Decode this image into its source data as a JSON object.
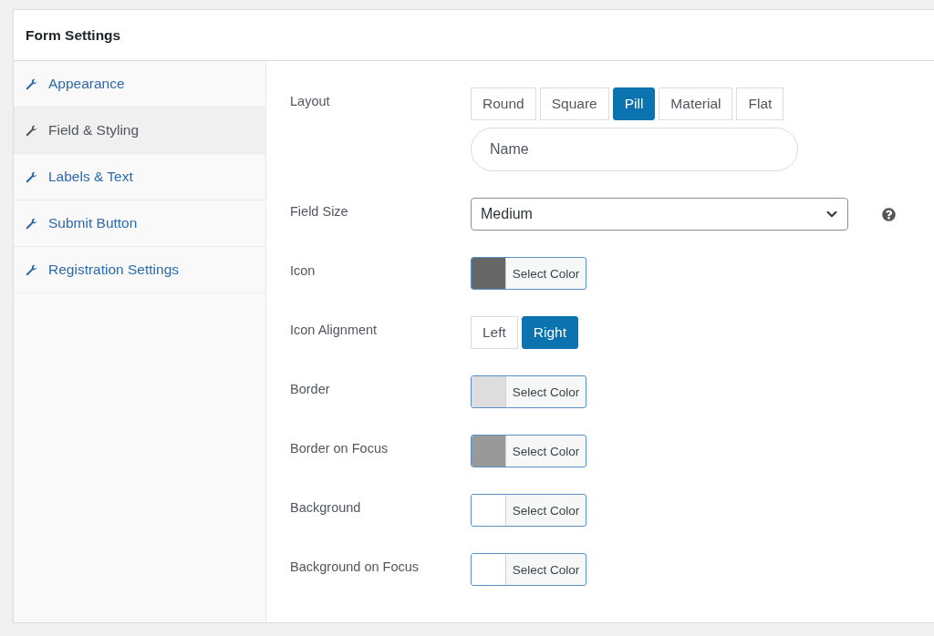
{
  "panel": {
    "title": "Form Settings"
  },
  "sidebar": {
    "items": [
      {
        "label": "Appearance",
        "selected": false
      },
      {
        "label": "Field & Styling",
        "selected": true
      },
      {
        "label": "Labels & Text",
        "selected": false
      },
      {
        "label": "Submit Button",
        "selected": false
      },
      {
        "label": "Registration Settings",
        "selected": false
      }
    ]
  },
  "settings": [
    {
      "kind": "buttons",
      "label": "Layout",
      "options": [
        {
          "label": "Round",
          "selected": false
        },
        {
          "label": "Square",
          "selected": false
        },
        {
          "label": "Pill",
          "selected": true
        },
        {
          "label": "Material",
          "selected": false
        },
        {
          "label": "Flat",
          "selected": false
        }
      ],
      "preview": {
        "placeholder": "Name"
      }
    },
    {
      "kind": "select",
      "label": "Field Size",
      "value": "Medium"
    },
    {
      "kind": "color",
      "label": "Icon",
      "color": "#666666",
      "button": "Select Color"
    },
    {
      "kind": "buttons",
      "label": "Icon Alignment",
      "options": [
        {
          "label": "Left",
          "selected": false
        },
        {
          "label": "Right",
          "selected": true
        }
      ]
    },
    {
      "kind": "color",
      "label": "Border",
      "color": "#dddddd",
      "button": "Select Color"
    },
    {
      "kind": "color",
      "label": "Border on Focus",
      "color": "#999999",
      "button": "Select Color"
    },
    {
      "kind": "color",
      "label": "Background",
      "color": "#ffffff",
      "button": "Select Color"
    },
    {
      "kind": "color",
      "label": "Background on Focus",
      "color": "#ffffff",
      "button": "Select Color"
    }
  ]
}
